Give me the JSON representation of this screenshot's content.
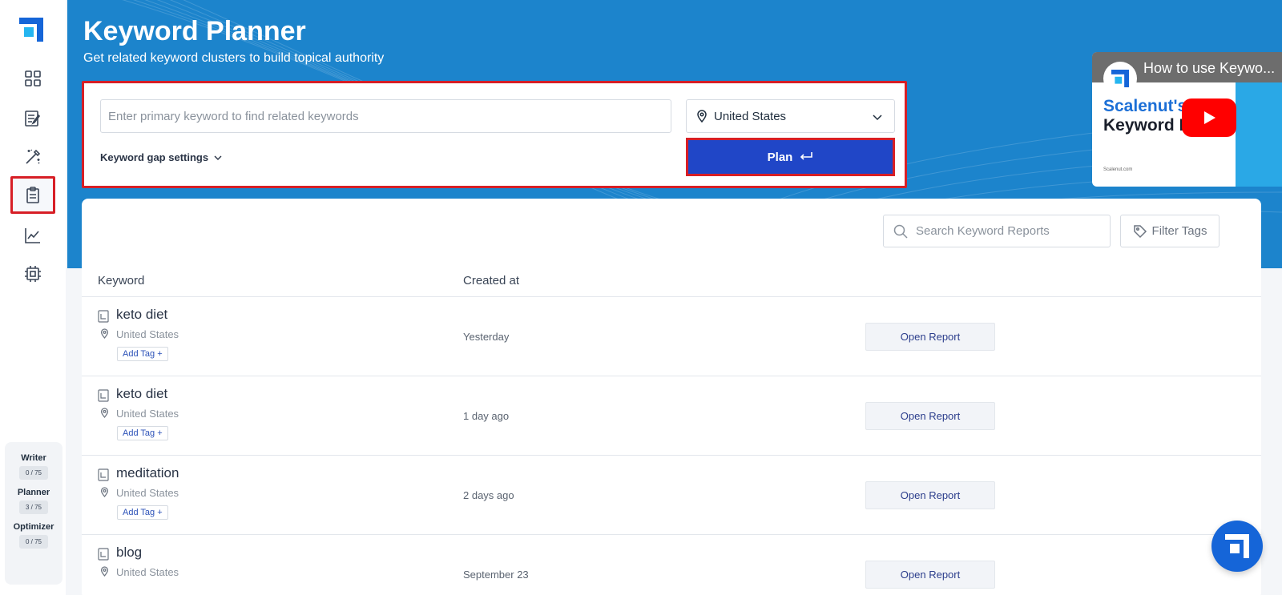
{
  "header": {
    "title": "Keyword Planner",
    "subtitle": "Get related keyword clusters to build topical authority"
  },
  "planner_form": {
    "keyword_placeholder": "Enter primary keyword to find related keywords",
    "location": "United States",
    "gap_settings_label": "Keyword gap settings",
    "plan_label": "Plan"
  },
  "video": {
    "title": "How to use Keywo...",
    "brand_line1": "Scalenut's",
    "brand_line2": "Keyword P...r",
    "footer": "Scalenut.com"
  },
  "sidebar": {
    "items": [
      "dashboard-icon",
      "writer-icon",
      "magic-wand-icon",
      "planner-icon",
      "analytics-icon",
      "chip-icon"
    ],
    "usage": [
      {
        "label": "Writer",
        "count": "0 / 75"
      },
      {
        "label": "Planner",
        "count": "3 / 75"
      },
      {
        "label": "Optimizer",
        "count": "0 / 75"
      }
    ]
  },
  "reports": {
    "search_placeholder": "Search Keyword Reports",
    "filter_label": "Filter Tags",
    "columns": {
      "keyword": "Keyword",
      "created": "Created at"
    },
    "add_tag_label": "Add Tag +",
    "open_label": "Open Report",
    "rows": [
      {
        "keyword": "keto diet",
        "location": "United States",
        "created": "Yesterday"
      },
      {
        "keyword": "keto diet",
        "location": "United States",
        "created": "1 day ago"
      },
      {
        "keyword": "meditation",
        "location": "United States",
        "created": "2 days ago"
      },
      {
        "keyword": "blog",
        "location": "United States",
        "created": "September 23"
      }
    ]
  },
  "colors": {
    "hero": "#1c84cc",
    "primary_button": "#2046c7",
    "highlight": "#d71f26"
  }
}
